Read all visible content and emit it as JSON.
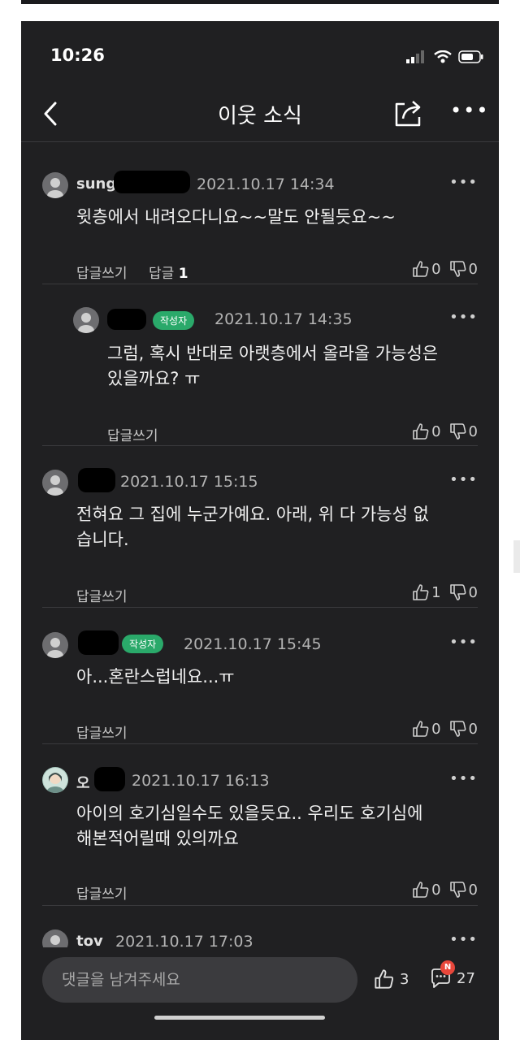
{
  "status": {
    "time": "10:26"
  },
  "nav": {
    "title": "이웃 소식"
  },
  "comments": [
    {
      "name": "sung",
      "badge": "",
      "date": "2021.10.17 14:34",
      "text_lines": [
        "윗층에서 내려오다니요~~말도 안될듯요~~"
      ],
      "reply_label": "답글쓰기",
      "replies_label": "답글",
      "replies_count": "1",
      "likes": "0",
      "dislikes": "0"
    },
    {
      "name": "",
      "badge": "작성자",
      "date": "2021.10.17 14:35",
      "text_lines": [
        "그럼, 혹시 반대로 아랫층에서 올라올 가능성은",
        "있을까요? ㅠ"
      ],
      "reply_label": "답글쓰기",
      "likes": "0",
      "dislikes": "0"
    },
    {
      "name": "",
      "badge": "",
      "date": "2021.10.17 15:15",
      "text_lines": [
        "전혀요 그 집에 누군가예요. 아래, 위 다 가능성 없",
        "습니다."
      ],
      "reply_label": "답글쓰기",
      "likes": "1",
      "dislikes": "0"
    },
    {
      "name": "",
      "badge": "작성자",
      "date": "2021.10.17 15:45",
      "text_lines": [
        "아...혼란스럽네요...ㅠ"
      ],
      "reply_label": "답글쓰기",
      "likes": "0",
      "dislikes": "0"
    },
    {
      "name": "오",
      "badge": "",
      "date": "2021.10.17 16:13",
      "text_lines": [
        "아이의 호기심일수도 있을듯요.. 우리도 호기심에",
        "해본적어릴때 있의까요"
      ],
      "reply_label": "답글쓰기",
      "likes": "0",
      "dislikes": "0"
    },
    {
      "name": "tov",
      "badge": "",
      "date": "2021.10.17 17:03"
    }
  ],
  "bottom": {
    "placeholder": "댓글을 남겨주세요",
    "like_count": "3",
    "comment_count": "27",
    "notification_badge": "N"
  },
  "icons": [
    "back-chevron-icon",
    "share-icon",
    "more-icon",
    "signal-icon",
    "wifi-icon",
    "battery-icon",
    "thumbs-up-icon",
    "thumbs-down-icon",
    "comment-bubble-icon"
  ],
  "colors": {
    "background": "#202022",
    "author_badge": "#2aa96a",
    "notification": "#e8473b"
  }
}
